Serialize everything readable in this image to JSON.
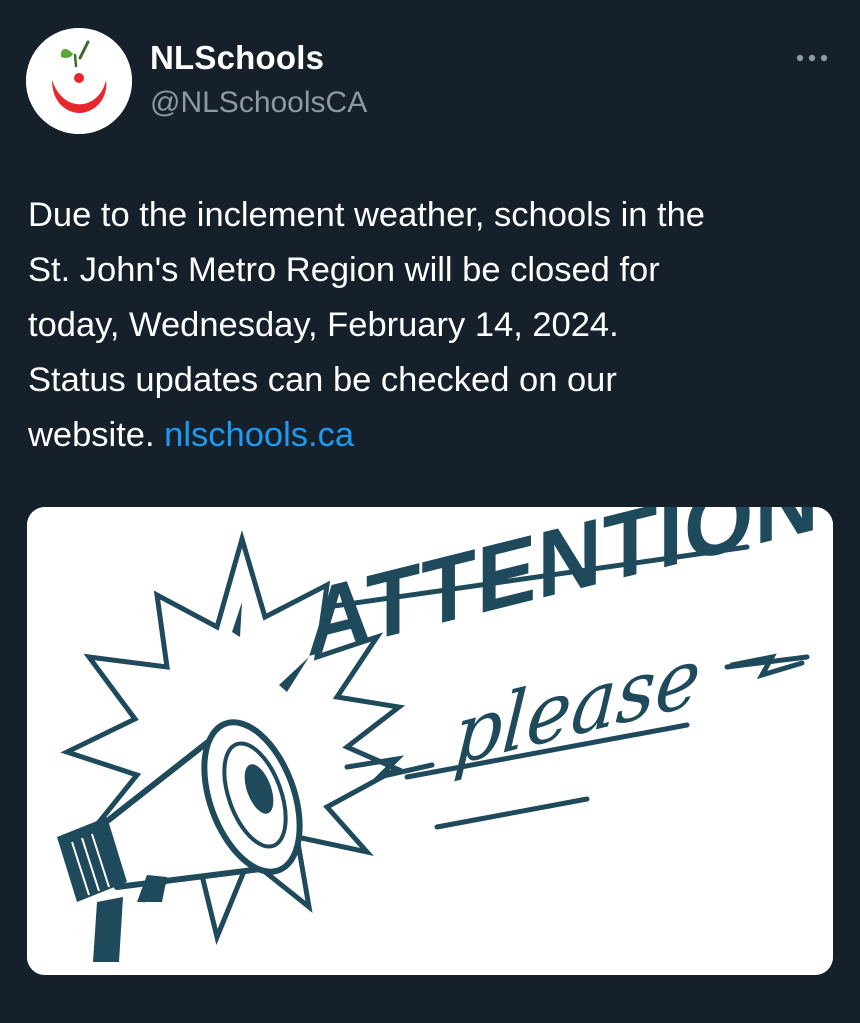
{
  "account": {
    "display_name": "NLSchools",
    "handle": "@NLSchoolsCA"
  },
  "header": {
    "more_icon": "more-horizontal-icon"
  },
  "tweet": {
    "lines": [
      "Due to the inclement weather, schools in the",
      "St. John's Metro Region will be closed for",
      "today, Wednesday, February 14, 2024.",
      "Status updates can be checked on our"
    ],
    "last_line_prefix": "website. ",
    "link_text": "nlschools.ca"
  },
  "media": {
    "headline": "ATTENTION",
    "subline": "please",
    "icon": "megaphone-icon"
  },
  "colors": {
    "background": "#15202b",
    "text": "#ffffff",
    "secondary_text": "#8b98a5",
    "link": "#1d9bf0",
    "illustration": "#1f4a5c",
    "logo_red": "#e8262c",
    "logo_green": "#5aa83a"
  }
}
